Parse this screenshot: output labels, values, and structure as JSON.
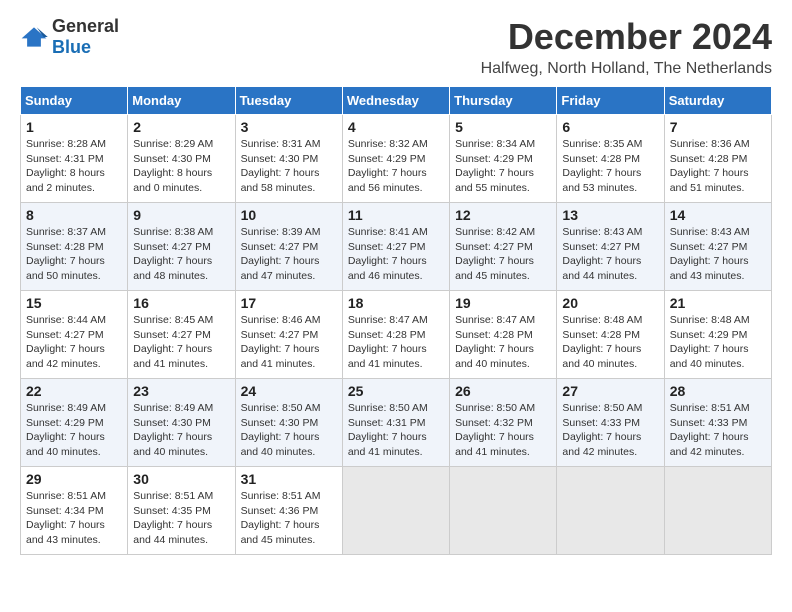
{
  "header": {
    "logo": {
      "general": "General",
      "blue": "Blue"
    },
    "title": "December 2024",
    "location": "Halfweg, North Holland, The Netherlands"
  },
  "calendar": {
    "days_of_week": [
      "Sunday",
      "Monday",
      "Tuesday",
      "Wednesday",
      "Thursday",
      "Friday",
      "Saturday"
    ],
    "weeks": [
      [
        null,
        {
          "day": 1,
          "sunrise": "8:28 AM",
          "sunset": "4:31 PM",
          "daylight": "8 hours and 2 minutes."
        },
        {
          "day": 2,
          "sunrise": "8:29 AM",
          "sunset": "4:30 PM",
          "daylight": "8 hours and 0 minutes."
        },
        {
          "day": 3,
          "sunrise": "8:31 AM",
          "sunset": "4:30 PM",
          "daylight": "7 hours and 58 minutes."
        },
        {
          "day": 4,
          "sunrise": "8:32 AM",
          "sunset": "4:29 PM",
          "daylight": "7 hours and 56 minutes."
        },
        {
          "day": 5,
          "sunrise": "8:34 AM",
          "sunset": "4:29 PM",
          "daylight": "7 hours and 55 minutes."
        },
        {
          "day": 6,
          "sunrise": "8:35 AM",
          "sunset": "4:28 PM",
          "daylight": "7 hours and 53 minutes."
        },
        {
          "day": 7,
          "sunrise": "8:36 AM",
          "sunset": "4:28 PM",
          "daylight": "7 hours and 51 minutes."
        }
      ],
      [
        {
          "day": 8,
          "sunrise": "8:37 AM",
          "sunset": "4:28 PM",
          "daylight": "7 hours and 50 minutes."
        },
        {
          "day": 9,
          "sunrise": "8:38 AM",
          "sunset": "4:27 PM",
          "daylight": "7 hours and 48 minutes."
        },
        {
          "day": 10,
          "sunrise": "8:39 AM",
          "sunset": "4:27 PM",
          "daylight": "7 hours and 47 minutes."
        },
        {
          "day": 11,
          "sunrise": "8:41 AM",
          "sunset": "4:27 PM",
          "daylight": "7 hours and 46 minutes."
        },
        {
          "day": 12,
          "sunrise": "8:42 AM",
          "sunset": "4:27 PM",
          "daylight": "7 hours and 45 minutes."
        },
        {
          "day": 13,
          "sunrise": "8:43 AM",
          "sunset": "4:27 PM",
          "daylight": "7 hours and 44 minutes."
        },
        {
          "day": 14,
          "sunrise": "8:43 AM",
          "sunset": "4:27 PM",
          "daylight": "7 hours and 43 minutes."
        }
      ],
      [
        {
          "day": 15,
          "sunrise": "8:44 AM",
          "sunset": "4:27 PM",
          "daylight": "7 hours and 42 minutes."
        },
        {
          "day": 16,
          "sunrise": "8:45 AM",
          "sunset": "4:27 PM",
          "daylight": "7 hours and 41 minutes."
        },
        {
          "day": 17,
          "sunrise": "8:46 AM",
          "sunset": "4:27 PM",
          "daylight": "7 hours and 41 minutes."
        },
        {
          "day": 18,
          "sunrise": "8:47 AM",
          "sunset": "4:28 PM",
          "daylight": "7 hours and 41 minutes."
        },
        {
          "day": 19,
          "sunrise": "8:47 AM",
          "sunset": "4:28 PM",
          "daylight": "7 hours and 40 minutes."
        },
        {
          "day": 20,
          "sunrise": "8:48 AM",
          "sunset": "4:28 PM",
          "daylight": "7 hours and 40 minutes."
        },
        {
          "day": 21,
          "sunrise": "8:48 AM",
          "sunset": "4:29 PM",
          "daylight": "7 hours and 40 minutes."
        }
      ],
      [
        {
          "day": 22,
          "sunrise": "8:49 AM",
          "sunset": "4:29 PM",
          "daylight": "7 hours and 40 minutes."
        },
        {
          "day": 23,
          "sunrise": "8:49 AM",
          "sunset": "4:30 PM",
          "daylight": "7 hours and 40 minutes."
        },
        {
          "day": 24,
          "sunrise": "8:50 AM",
          "sunset": "4:30 PM",
          "daylight": "7 hours and 40 minutes."
        },
        {
          "day": 25,
          "sunrise": "8:50 AM",
          "sunset": "4:31 PM",
          "daylight": "7 hours and 41 minutes."
        },
        {
          "day": 26,
          "sunrise": "8:50 AM",
          "sunset": "4:32 PM",
          "daylight": "7 hours and 41 minutes."
        },
        {
          "day": 27,
          "sunrise": "8:50 AM",
          "sunset": "4:33 PM",
          "daylight": "7 hours and 42 minutes."
        },
        {
          "day": 28,
          "sunrise": "8:51 AM",
          "sunset": "4:33 PM",
          "daylight": "7 hours and 42 minutes."
        }
      ],
      [
        {
          "day": 29,
          "sunrise": "8:51 AM",
          "sunset": "4:34 PM",
          "daylight": "7 hours and 43 minutes."
        },
        {
          "day": 30,
          "sunrise": "8:51 AM",
          "sunset": "4:35 PM",
          "daylight": "7 hours and 44 minutes."
        },
        {
          "day": 31,
          "sunrise": "8:51 AM",
          "sunset": "4:36 PM",
          "daylight": "7 hours and 45 minutes."
        },
        null,
        null,
        null,
        null
      ]
    ]
  }
}
